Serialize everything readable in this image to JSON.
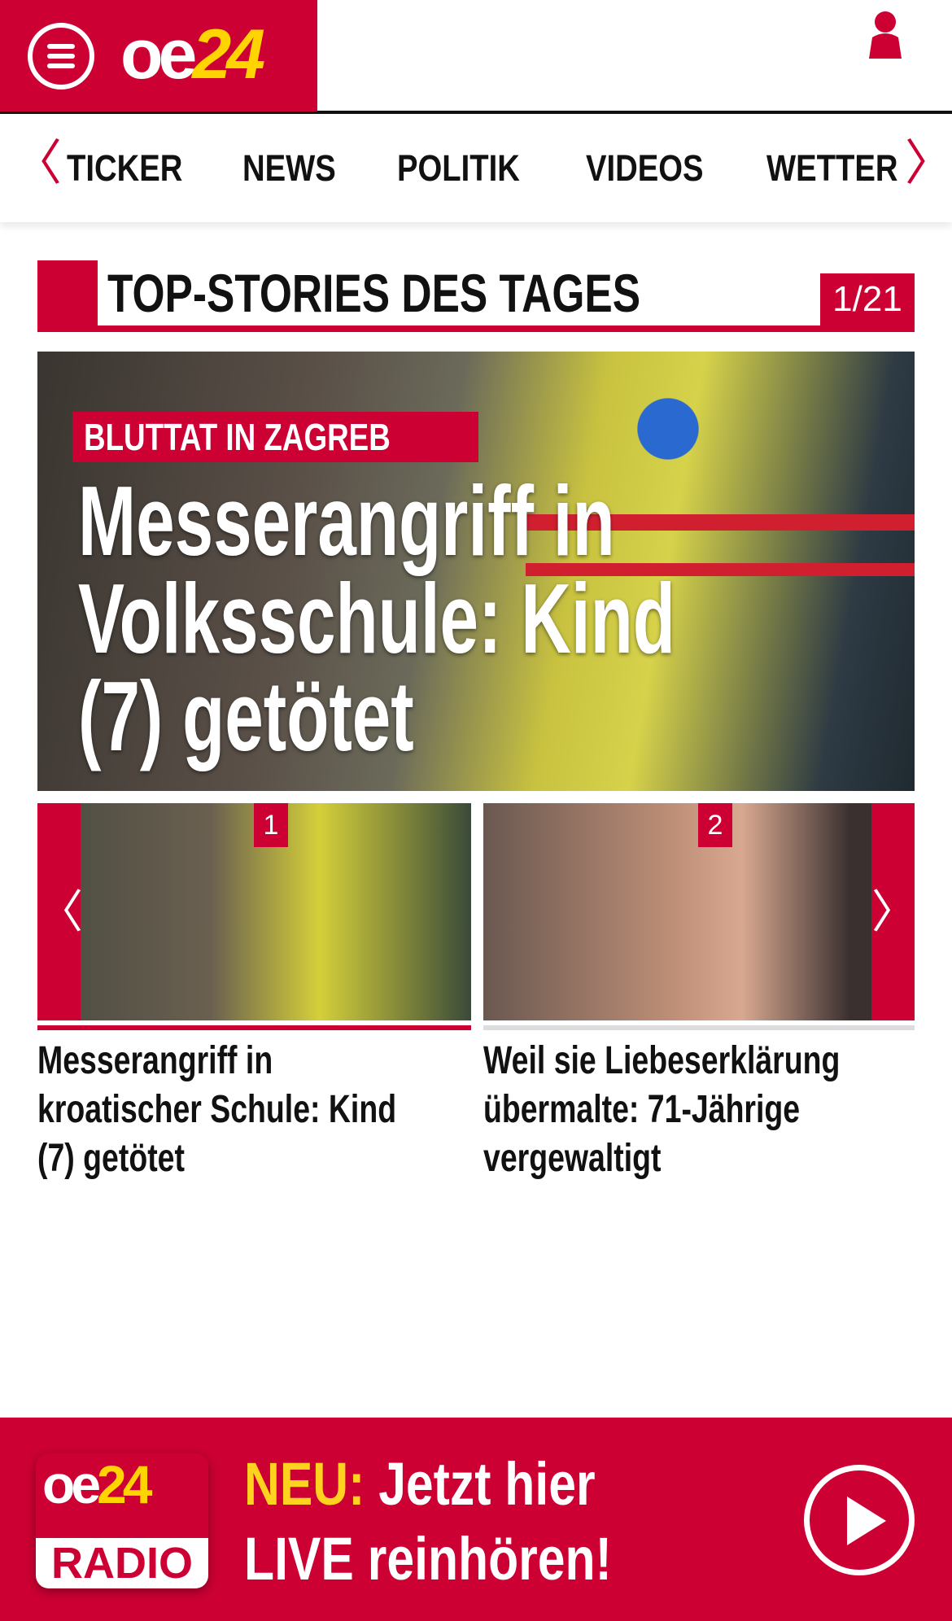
{
  "header": {
    "logo_text": "oe",
    "logo_accent": "24",
    "brand_color": "#cc0033",
    "accent_color": "#ffd400"
  },
  "nav": {
    "items": [
      "TICKER",
      "NEWS",
      "POLITIK",
      "VIDEOS",
      "WETTER"
    ],
    "prev": "〈",
    "next": "〉"
  },
  "section": {
    "title": "TOP-STORIES DES TAGES",
    "counter": "1/21"
  },
  "hero": {
    "tag": "BLUTTAT IN ZAGREB",
    "headline": "Messerangriff in Volksschule: Kind (7) getötet"
  },
  "carousel": {
    "prev": "〈",
    "next": "〉",
    "cards": [
      {
        "number": "1",
        "caption": "Messerangriff in kroatischer Schule: Kind (7) getötet"
      },
      {
        "number": "2",
        "caption": "Weil sie Liebeserklärung übermalte: 71-Jährige vergewaltigt"
      }
    ]
  },
  "footer": {
    "logo_text": "oe",
    "logo_accent": "24",
    "logo_sub": "RADIO",
    "promo_highlight": "NEU:",
    "promo_line1": " Jetzt hier",
    "promo_line2": "LIVE reinhören!"
  }
}
